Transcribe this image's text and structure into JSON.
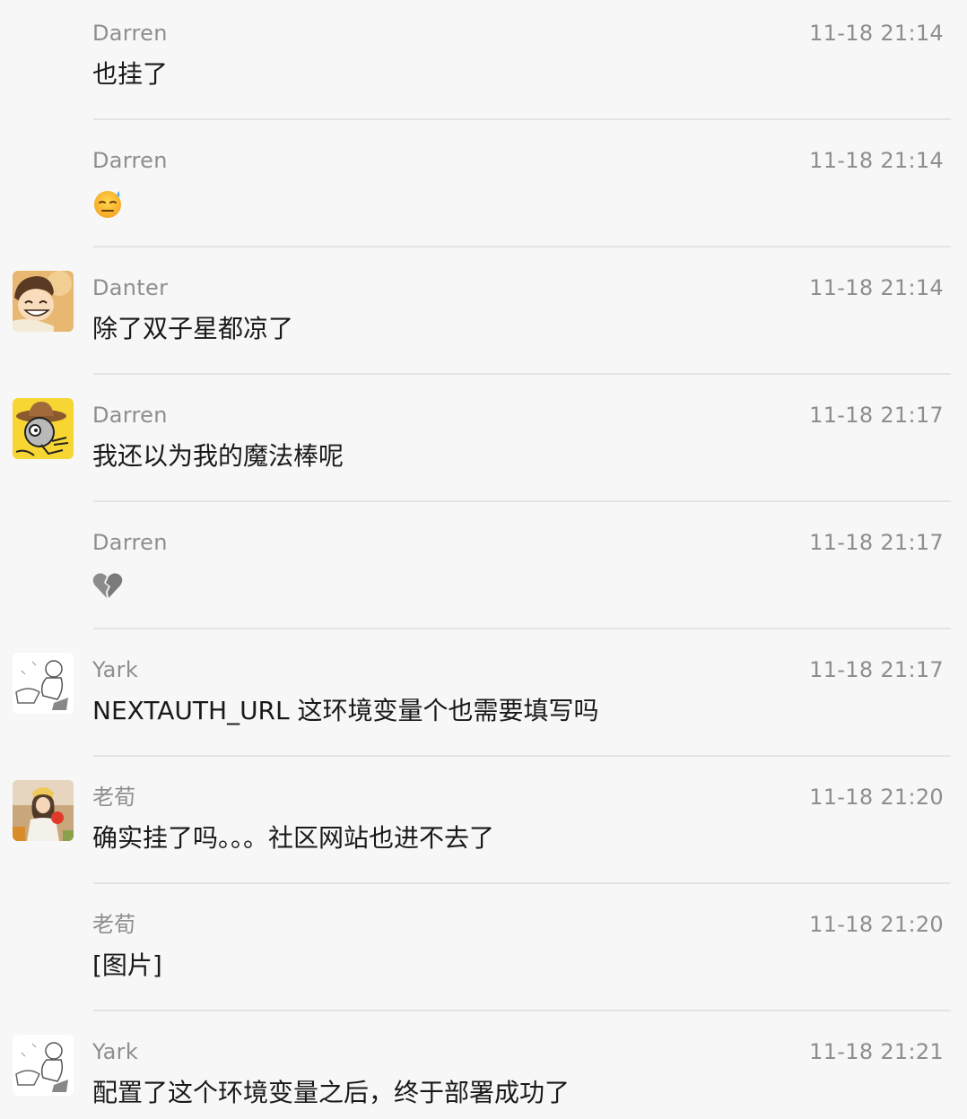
{
  "messages": [
    {
      "sender": "Darren",
      "time": "11-18 21:14",
      "text": "也挂了",
      "avatar": ""
    },
    {
      "sender": "Darren",
      "time": "11-18 21:14",
      "text": "",
      "emoji": "sweat-smile-emoji",
      "avatar": ""
    },
    {
      "sender": "Danter",
      "time": "11-18 21:14",
      "text": "除了双子星都凉了",
      "avatar": "cartoon-boy-avatar"
    },
    {
      "sender": "Darren",
      "time": "11-18 21:17",
      "text": "我还以为我的魔法棒呢",
      "avatar": "cowboy-cartoon-avatar"
    },
    {
      "sender": "Darren",
      "time": "11-18 21:17",
      "text": "",
      "emoji": "broken-heart-emoji",
      "avatar": ""
    },
    {
      "sender": "Yark",
      "time": "11-18 21:17",
      "text": "NEXTAUTH_URL 这环境变量个也需要填写吗",
      "avatar": "sketch-avatar"
    },
    {
      "sender": "老荀",
      "time": "11-18 21:20",
      "text": "确实挂了吗。。。社区网站也进不去了",
      "avatar": "photo-girl-avatar"
    },
    {
      "sender": "老荀",
      "time": "11-18 21:20",
      "text": "[图片]",
      "avatar": ""
    },
    {
      "sender": "Yark",
      "time": "11-18 21:21",
      "text": "配置了这个环境变量之后，终于部署成功了",
      "avatar": "sketch-avatar"
    }
  ],
  "colors": {
    "background": "#f7f7f7",
    "meta_text": "#8e8e8e",
    "body_text": "#191919",
    "divider": "#e4e4e4"
  }
}
